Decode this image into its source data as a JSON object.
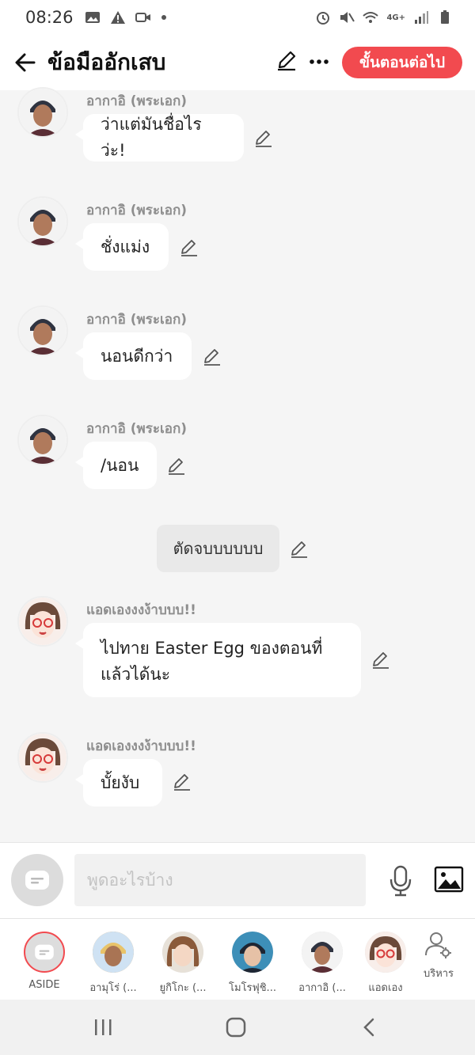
{
  "status_bar": {
    "time": "08:26",
    "network": "4G+"
  },
  "header": {
    "title": "ข้อมืออักเสบ",
    "next_label": "ขั้นตอนต่อไป"
  },
  "messages": [
    {
      "sender": "อากาอิ (พระเอก)",
      "text": "ว่าแต่มันชื่อไรว่ะ!"
    },
    {
      "sender": "อากาอิ (พระเอก)",
      "text": "ชั่งแม่ง"
    },
    {
      "sender": "อากาอิ (พระเอก)",
      "text": "นอนดีกว่า"
    },
    {
      "sender": "อากาอิ (พระเอก)",
      "text": "/นอน"
    },
    {
      "narration": "ตัดจบบบบบบ"
    },
    {
      "sender": "แอดเองงงง้าบบบ!!",
      "text_line1": "ไปทาย Easter Egg ของตอนที่",
      "text_line2": "แล้วได้นะ"
    },
    {
      "sender": "แอดเองงงง้าบบบ!!",
      "text": "บั้ยงับ"
    }
  ],
  "composer": {
    "placeholder": "พูดอะไรบ้าง"
  },
  "characters": [
    {
      "label": "ASIDE"
    },
    {
      "label": "อามุโร่ (...",
      "color": "#d8b27a"
    },
    {
      "label": "ยูกิโกะ (...",
      "color": "#8a5a3a"
    },
    {
      "label": "โมโรฟุชิ...",
      "color": "#2b3b52"
    },
    {
      "label": "อากาอิ (...",
      "color": "#3a3f4c"
    },
    {
      "label": "แอดเอง",
      "color": "#6b4a3a"
    }
  ],
  "manage_label": "บริหาร",
  "colors": {
    "accent": "#f24a4f"
  }
}
